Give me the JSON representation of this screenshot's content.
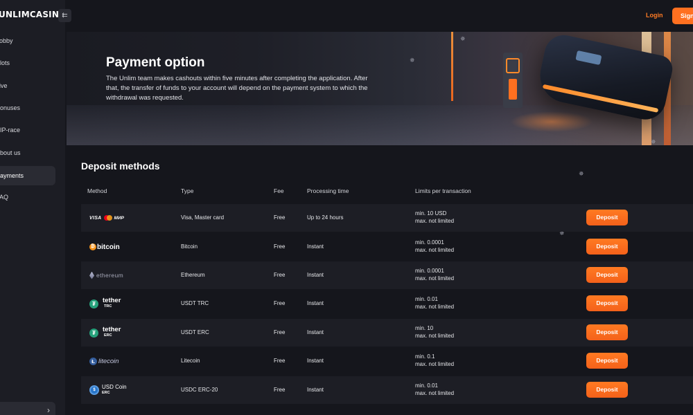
{
  "sidebar": {
    "logo": "UNLIMCASINO",
    "items": [
      {
        "label": "Lobby",
        "active": false
      },
      {
        "label": "Slots",
        "active": false
      },
      {
        "label": "Live",
        "active": false
      },
      {
        "label": "Bonuses",
        "active": false
      },
      {
        "label": "VIP-race",
        "active": false
      },
      {
        "label": "About us",
        "active": false
      },
      {
        "label": "Payments",
        "active": true
      },
      {
        "label": "FAQ",
        "active": false
      }
    ]
  },
  "header": {
    "login_label": "Login",
    "signup_label": "Sign up"
  },
  "banner": {
    "title": "Payment option",
    "description": "The Unlim team makes cashouts within five minutes after completing the application. After that, the transfer of funds to your account will depend on the payment system to which the withdrawal was requested."
  },
  "deposit": {
    "title": "Deposit methods",
    "columns": [
      "Method",
      "Type",
      "Fee",
      "Processing time",
      "Limits per transaction"
    ],
    "button_label": "Deposit",
    "rows": [
      {
        "method_icon": "visa-mastercard-mir-logo",
        "type": "Visa, Master card",
        "fee": "Free",
        "processing": "Up to 24 hours",
        "limit_min": "min. 10 USD",
        "limit_max": "max. not limited"
      },
      {
        "method_icon": "bitcoin-logo",
        "method_text": "bitcoin",
        "type": "Bitcoin",
        "fee": "Free",
        "processing": "Instant",
        "limit_min": "min. 0.0001",
        "limit_max": "max. not limited"
      },
      {
        "method_icon": "ethereum-logo",
        "method_text": "ethereum",
        "type": "Ethereum",
        "fee": "Free",
        "processing": "Instant",
        "limit_min": "min. 0.0001",
        "limit_max": "max. not limited"
      },
      {
        "method_icon": "tether-logo",
        "method_text": "tether",
        "method_sub": "TRC",
        "type": "USDT TRC",
        "fee": "Free",
        "processing": "Instant",
        "limit_min": "min. 0.01",
        "limit_max": "max. not limited"
      },
      {
        "method_icon": "tether-logo",
        "method_text": "tether",
        "method_sub": "ERC",
        "type": "USDT ERC",
        "fee": "Free",
        "processing": "Instant",
        "limit_min": "min. 10",
        "limit_max": "max. not limited"
      },
      {
        "method_icon": "litecoin-logo",
        "method_text": "litecoin",
        "type": "Litecoin",
        "fee": "Free",
        "processing": "Instant",
        "limit_min": "min. 0.1",
        "limit_max": "max. not limited"
      },
      {
        "method_icon": "usd-coin-logo",
        "method_text": "USD Coin",
        "method_sub": "ERC",
        "type": "USDC ERC-20",
        "fee": "Free",
        "processing": "Instant",
        "limit_min": "min. 0.01",
        "limit_max": "max. not limited"
      }
    ]
  },
  "colors": {
    "accent": "#ff7020",
    "background": "#15161c",
    "sidebar": "#1c1d24"
  }
}
